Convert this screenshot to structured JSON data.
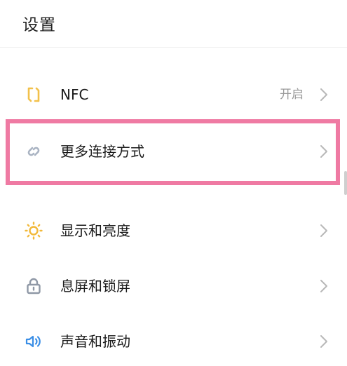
{
  "header": {
    "title": "设置"
  },
  "items": [
    {
      "label": "NFC",
      "value": "开启",
      "icon": "nfc-icon",
      "icon_color": "#f2c14b"
    },
    {
      "label": "更多连接方式",
      "value": "",
      "icon": "link-icon",
      "icon_color": "#a9b3c2"
    },
    {
      "label": "显示和亮度",
      "value": "",
      "icon": "sun-icon",
      "icon_color": "#f2b93b"
    },
    {
      "label": "息屏和锁屏",
      "value": "",
      "icon": "lock-icon",
      "icon_color": "#8f98a6"
    },
    {
      "label": "声音和振动",
      "value": "",
      "icon": "speaker-icon",
      "icon_color": "#3a8ee6"
    }
  ],
  "colors": {
    "highlight": "#ef7aa3",
    "chevron": "#b8b8b8",
    "value_text": "#9a9a9a"
  }
}
